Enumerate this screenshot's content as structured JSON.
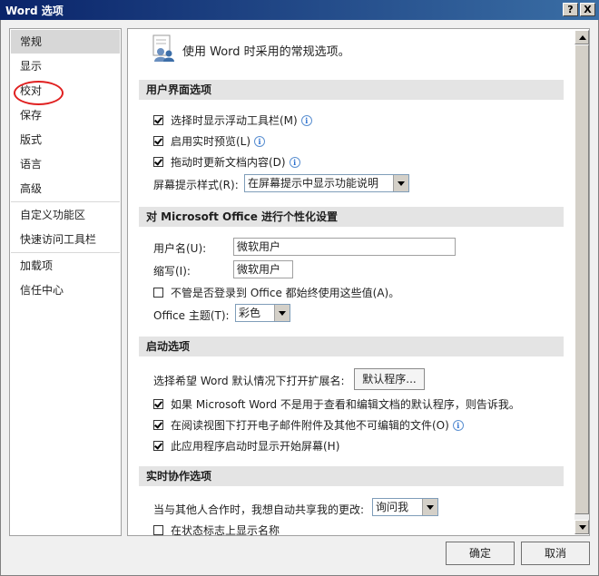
{
  "window": {
    "title": "Word 选项",
    "help_glyph": "?",
    "close_glyph": "X"
  },
  "nav": {
    "items": [
      {
        "label": "常规",
        "selected": true
      },
      {
        "label": "显示"
      },
      {
        "label": "校对"
      },
      {
        "label": "保存"
      },
      {
        "label": "版式"
      },
      {
        "label": "语言"
      },
      {
        "label": "高级"
      },
      {
        "label": "自定义功能区"
      },
      {
        "label": "快速访问工具栏"
      },
      {
        "label": "加载项"
      },
      {
        "label": "信任中心"
      }
    ]
  },
  "content": {
    "header": "使用 Word 时采用的常规选项。",
    "ui_section": {
      "title": "用户界面选项",
      "opt1": "选择时显示浮动工具栏(M)",
      "opt2": "启用实时预览(L)",
      "opt3": "拖动时更新文档内容(D)",
      "screentip_label": "屏幕提示样式(R):",
      "screentip_value": "在屏幕提示中显示功能说明"
    },
    "personalize_section": {
      "title": "对 Microsoft Office 进行个性化设置",
      "username_label": "用户名(U):",
      "username_value": "微软用户",
      "initials_label": "缩写(I):",
      "initials_value": "微软用户",
      "always_use": "不管是否登录到 Office 都始终使用这些值(A)。",
      "theme_label": "Office 主题(T):",
      "theme_value": "彩色"
    },
    "startup_section": {
      "title": "启动选项",
      "ext_label": "选择希望 Word 默认情况下打开扩展名:",
      "default_programs": "默认程序...",
      "opt1": "如果 Microsoft Word 不是用于查看和编辑文档的默认程序，则告诉我。",
      "opt2": "在阅读视图下打开电子邮件附件及其他不可编辑的文件(O)",
      "opt3": "此应用程序启动时显示开始屏幕(H)"
    },
    "coauth_section": {
      "title": "实时协作选项",
      "share_label": "当与其他人合作时，我想自动共享我的更改:",
      "share_value": "询问我",
      "show_names": "在状态标志上显示名称"
    }
  },
  "footer": {
    "ok": "确定",
    "cancel": "取消"
  },
  "colors": {
    "title_bar": "#0a246a",
    "annotation_circle": "#e02020",
    "section_bg": "#e4e4e4"
  }
}
